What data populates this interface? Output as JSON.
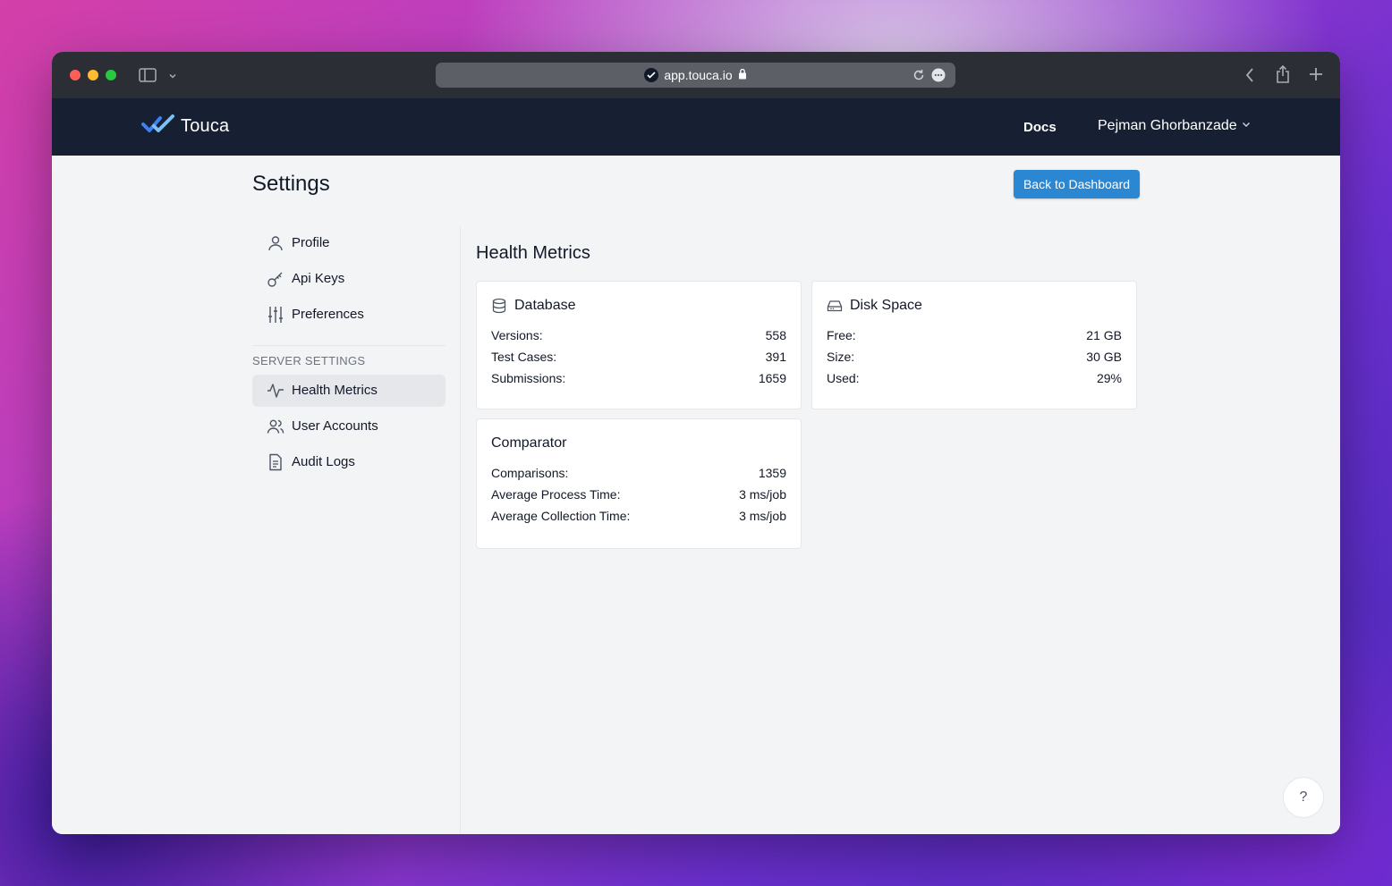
{
  "browser": {
    "url": "app.touca.io"
  },
  "navbar": {
    "brand": "Touca",
    "docs": "Docs",
    "user": "Pejman Ghorbanzade"
  },
  "page": {
    "title": "Settings",
    "back_button": "Back to Dashboard"
  },
  "sidebar": {
    "items": [
      {
        "label": "Profile",
        "icon": "user-icon"
      },
      {
        "label": "Api Keys",
        "icon": "key-icon"
      },
      {
        "label": "Preferences",
        "icon": "sliders-icon"
      }
    ],
    "section_title": "SERVER SETTINGS",
    "server_items": [
      {
        "label": "Health Metrics",
        "icon": "activity-icon",
        "active": true
      },
      {
        "label": "User Accounts",
        "icon": "users-icon"
      },
      {
        "label": "Audit Logs",
        "icon": "document-icon"
      }
    ]
  },
  "main": {
    "title": "Health Metrics",
    "cards": {
      "database": {
        "title": "Database",
        "rows": [
          {
            "label": "Versions:",
            "value": "558"
          },
          {
            "label": "Test Cases:",
            "value": "391"
          },
          {
            "label": "Submissions:",
            "value": "1659"
          }
        ]
      },
      "disk": {
        "title": "Disk Space",
        "rows": [
          {
            "label": "Free:",
            "value": "21 GB"
          },
          {
            "label": "Size:",
            "value": "30 GB"
          },
          {
            "label": "Used:",
            "value": "29%"
          }
        ]
      },
      "comparator": {
        "title": "Comparator",
        "rows": [
          {
            "label": "Comparisons:",
            "value": "1359"
          },
          {
            "label": "Average Process Time:",
            "value": "3 ms/job"
          },
          {
            "label": "Average Collection Time:",
            "value": "3 ms/job"
          }
        ]
      }
    }
  },
  "help": {
    "label": "?"
  },
  "colors": {
    "navbar": "#172033",
    "accent": "#2b87d1",
    "background": "#f3f4f6"
  }
}
